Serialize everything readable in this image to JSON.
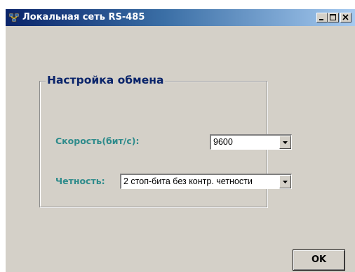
{
  "window": {
    "title": "Локальная сеть RS-485",
    "controls": [
      "minimize",
      "maximize",
      "close"
    ]
  },
  "group": {
    "title": "Настройка обмена",
    "speed": {
      "label": "Скорость(бит/с):",
      "value": "9600"
    },
    "parity": {
      "label": "Четность:",
      "value": "2 стоп-бита без контр. четности"
    }
  },
  "buttons": {
    "ok_label": "OK"
  },
  "colors": {
    "title_bar": "#0a246a",
    "window_face": "#d4d0c8",
    "label_text": "#2e8b8b",
    "group_title": "#0a246a"
  },
  "icons": {
    "app": "network-computers-icon",
    "dropdown": "chevron-down-icon"
  }
}
